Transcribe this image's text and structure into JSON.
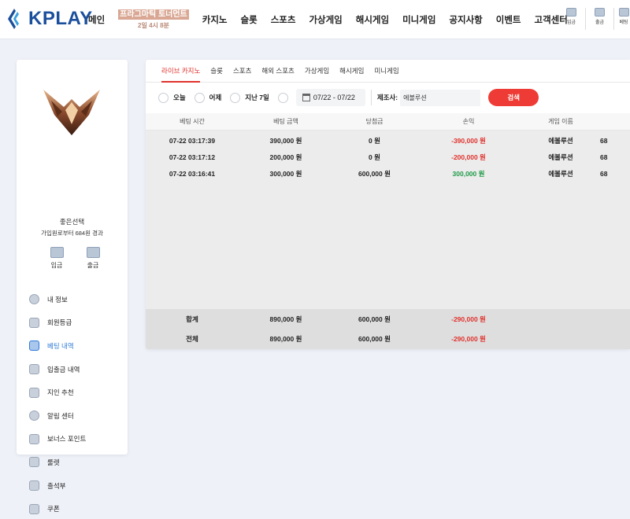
{
  "brand": {
    "name": "KPLAY",
    "color": "#1b4f9c"
  },
  "nav": {
    "items": [
      "메인",
      "카지노",
      "슬롯",
      "스포츠",
      "가상게임",
      "해시게임",
      "미니게임",
      "공지사항",
      "이벤트",
      "고객센터"
    ],
    "promo_line1": "프라그마틱 토너먼트",
    "promo_line2": "2일 4시 8분"
  },
  "header_icons": {
    "deposit": "입금",
    "withdraw": "출금",
    "bonus": "베팅"
  },
  "user": {
    "name": "좋은선택",
    "sub": "가입원로부터 684원 경과",
    "deposit": "입금",
    "withdraw": "출금"
  },
  "menu": [
    {
      "label": "내 정보",
      "icon": "user-icon"
    },
    {
      "label": "회원등급",
      "icon": "grade-icon"
    },
    {
      "label": "베팅 내역",
      "icon": "bet-history-icon"
    },
    {
      "label": "입출금 내역",
      "icon": "wallet-icon"
    },
    {
      "label": "지인 추천",
      "icon": "friend-icon"
    },
    {
      "label": "알림 센터",
      "icon": "bell-icon"
    },
    {
      "label": "보너스 포인트",
      "icon": "bonus-icon"
    },
    {
      "label": "룰렛",
      "icon": "roulette-icon"
    },
    {
      "label": "출석부",
      "icon": "calendar-icon"
    },
    {
      "label": "쿠폰",
      "icon": "coupon-icon"
    }
  ],
  "tabs": [
    "라이브 카지노",
    "슬롯",
    "스포츠",
    "해외 스포츠",
    "가상게임",
    "해시게임",
    "미니게임"
  ],
  "filters": {
    "today": "오늘",
    "yesterday": "어제",
    "last7": "지난 7일",
    "date_range": "07/22 - 07/22",
    "maker_label": "제조사:",
    "maker_value": "에볼루션",
    "search": "검색"
  },
  "table": {
    "headers": [
      "베팅 시간",
      "베팅 금액",
      "당첨금",
      "손익",
      "게임 이름"
    ],
    "rows": [
      {
        "time": "07-22 03:17:39",
        "bet": "390,000 원",
        "win": "0 원",
        "pl": "-390,000 원",
        "game": "에볼루션",
        "extra": "68"
      },
      {
        "time": "07-22 03:17:12",
        "bet": "200,000 원",
        "win": "0 원",
        "pl": "-200,000 원",
        "game": "에볼루션",
        "extra": "68"
      },
      {
        "time": "07-22 03:16:41",
        "bet": "300,000 원",
        "win": "600,000 원",
        "pl": "300,000 원",
        "game": "에볼루션",
        "extra": "68"
      }
    ],
    "subtotal": {
      "label": "합계",
      "bet": "890,000 원",
      "win": "600,000 원",
      "pl": "-290,000 원"
    },
    "total": {
      "label": "전체",
      "bet": "890,000 원",
      "win": "600,000 원",
      "pl": "-290,000 원"
    }
  },
  "colors": {
    "accent_red": "#e0312c",
    "positive": "#1f9a48",
    "active_blue": "#2e7bd8"
  }
}
